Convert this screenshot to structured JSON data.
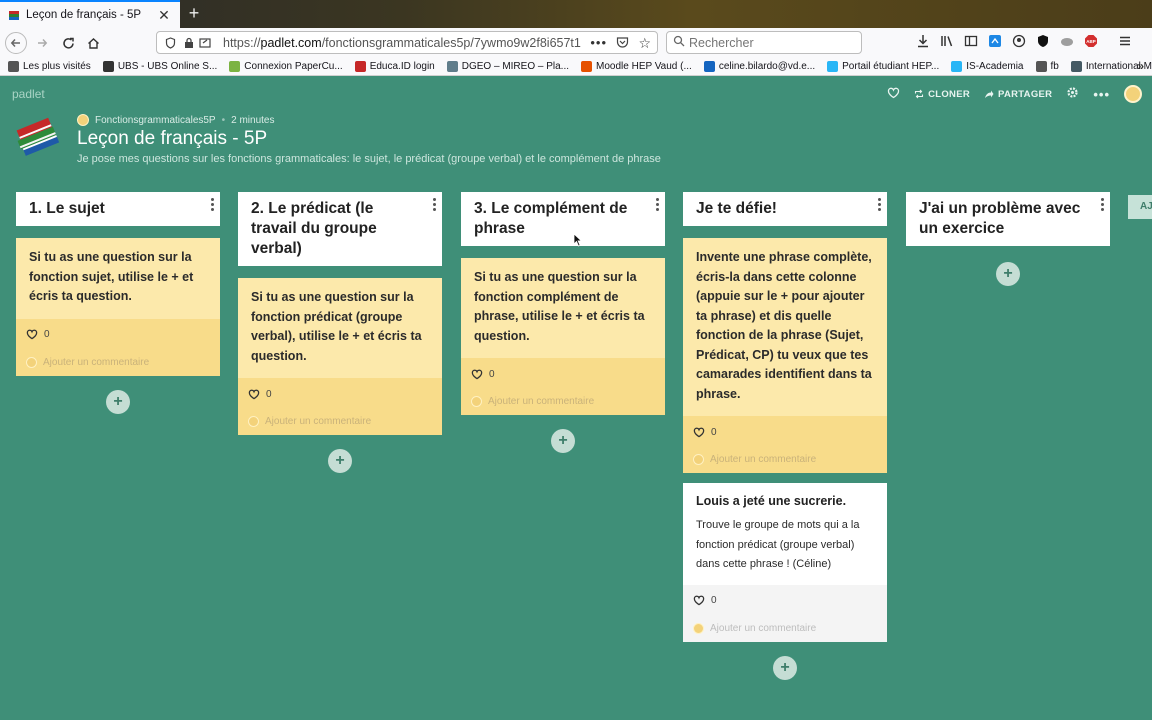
{
  "browser": {
    "tab_title": "Leçon de français - 5P",
    "url_prefix": "https://",
    "url_host": "padlet.com",
    "url_path": "/fonctionsgrammaticales5p/7ywmo9w2f8i657t1",
    "search_placeholder": "Rechercher",
    "bookmarks": [
      {
        "label": "Les plus visités",
        "color": "#555555"
      },
      {
        "label": "UBS - UBS Online S...",
        "color": "#333333"
      },
      {
        "label": "Connexion PaperCu...",
        "color": "#7cb342"
      },
      {
        "label": "Educa.ID login",
        "color": "#c62828"
      },
      {
        "label": "DGEO – MIREO – Pla...",
        "color": "#607d8b"
      },
      {
        "label": "Moodle HEP Vaud (...",
        "color": "#e65100"
      },
      {
        "label": "celine.bilardo@vd.e...",
        "color": "#1565c0"
      },
      {
        "label": "Portail étudiant HEP...",
        "color": "#29b6f6"
      },
      {
        "label": "IS-Academia",
        "color": "#29b6f6"
      },
      {
        "label": "fb",
        "color": "#555555"
      },
      {
        "label": "International Music ...",
        "color": "#455a64"
      }
    ]
  },
  "padlet": {
    "logo": "padlet",
    "clone_label": "CLONER",
    "share_label": "PARTAGER",
    "author": "Fonctionsgrammaticales5P",
    "time_ago": "2 minutes",
    "title": "Leçon de français - 5P",
    "description": "Je pose mes questions sur les fonctions grammaticales: le sujet, le prédicat (groupe verbal) et le complément de phrase",
    "partial_column_label": "AJ",
    "comment_placeholder": "Ajouter un commentaire",
    "add_symbol": "+"
  },
  "columns": [
    {
      "title": "1. Le sujet",
      "posts": [
        {
          "body": "Si tu as une question sur la fonction sujet, utilise le + et écris ta question.",
          "likes": "0"
        }
      ]
    },
    {
      "title": "2. Le prédicat (le travail du groupe verbal)",
      "posts": [
        {
          "body": "Si tu as une question sur la fonction prédicat (groupe verbal), utilise le + et écris ta question.",
          "likes": "0"
        }
      ]
    },
    {
      "title": "3. Le complément de phrase",
      "posts": [
        {
          "body": "Si tu as une question sur la fonction complément de phrase, utilise le + et écris ta question.",
          "likes": "0"
        }
      ]
    },
    {
      "title": "Je te défie!",
      "posts": [
        {
          "body": "Invente une phrase complète, écris-la dans cette colonne (appuie sur le + pour ajouter ta phrase) et dis quelle fonction de la phrase (Sujet, Prédicat, CP) tu veux que tes camarades identifient dans ta phrase.",
          "likes": "0"
        },
        {
          "title": "Louis a jeté une sucrerie.",
          "text": "Trouve le groupe de mots qui a la fonction prédicat (groupe verbal) dans cette phrase ! (Céline)",
          "likes": "0"
        }
      ]
    },
    {
      "title": "J'ai un problème avec un exercice",
      "posts": []
    }
  ],
  "colors": {
    "background": "#3f8f78",
    "post_yellow": "#fce9ab",
    "post_footer_yellow": "#f8dc8a",
    "accent_tab": "#0a84ff"
  }
}
